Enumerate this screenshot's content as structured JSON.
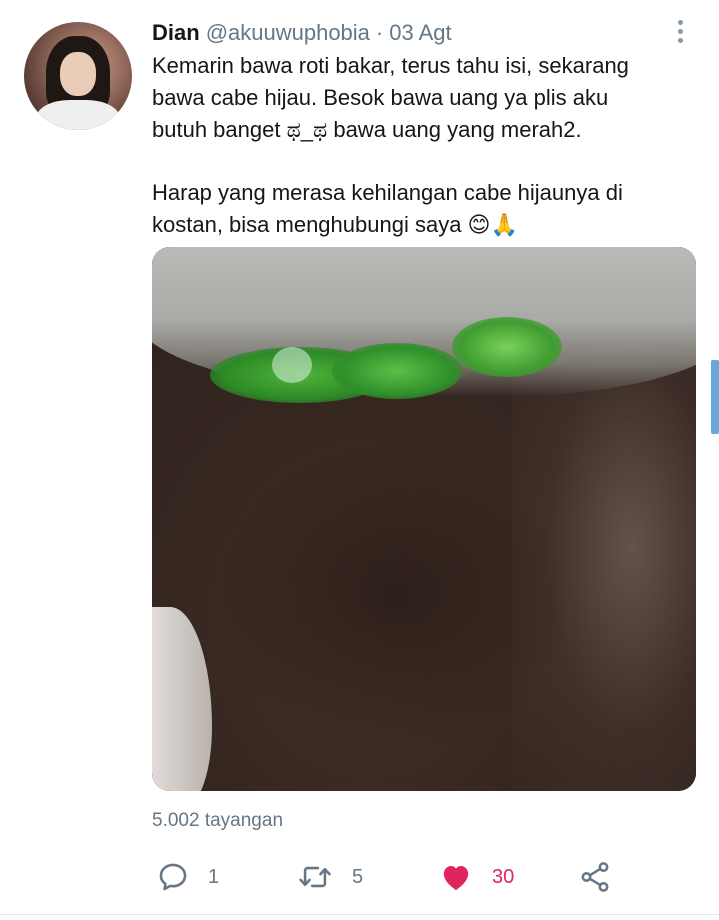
{
  "tweet": {
    "author": {
      "name": "Dian",
      "handle": "@akuuwuphobia",
      "separator": "·",
      "date": "03 Agt"
    },
    "text": {
      "line1": "Kemarin bawa roti bakar, terus tahu isi, sekarang",
      "line2": "bawa cabe hijau. Besok bawa uang ya plis aku",
      "line3": "butuh banget ಥ_ಥ bawa uang yang merah2.",
      "line4": "Harap yang merasa kehilangan cabe hijaunya di",
      "line5": "kostan, bisa menghubungi saya 😊🙏"
    },
    "views": "5.002 tayangan",
    "actions": {
      "reply_count": "1",
      "retweet_count": "5",
      "like_count": "30"
    }
  },
  "icons": {
    "more": "more-vertical-icon",
    "reply": "reply-icon",
    "retweet": "retweet-icon",
    "like": "heart-icon",
    "share": "share-icon"
  },
  "colors": {
    "text": "#14171a",
    "secondary": "#657786",
    "like": "#e0245e",
    "icon": "#657786",
    "scrollbar": "#6aa7d8"
  }
}
